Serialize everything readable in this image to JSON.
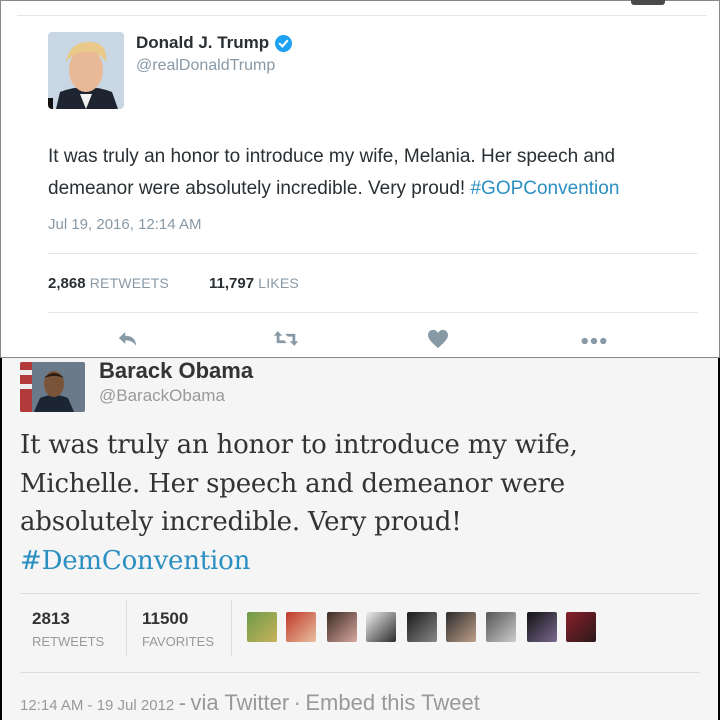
{
  "tweet1": {
    "name": "Donald J. Trump",
    "handle": "@realDonaldTrump",
    "text_line1": "It was truly an honor to introduce my wife, Melania. Her speech and",
    "text_line2_pre": "demeanor were absolutely incredible. Very proud! ",
    "hashtag": "#GOPConvention",
    "timestamp": "Jul 19, 2016, 12:14 AM",
    "retweets_count": "2,868",
    "retweets_label": "RETWEETS",
    "likes_count": "11,797",
    "likes_label": "LIKES",
    "verified_color": "#1da1f2",
    "icons": [
      "reply-icon",
      "retweet-icon",
      "heart-icon",
      "more-icon"
    ]
  },
  "tweet2": {
    "name": "Barack Obama",
    "handle": "@BarackObama",
    "text_line1": "It was truly an honor to introduce my wife,",
    "text_line2": "Michelle. Her speech and demeanor were",
    "text_line3": "absolutely incredible. Very proud!",
    "hashtag": "#DemConvention",
    "retweets_count": "2813",
    "retweets_label": "RETWEETS",
    "favorites_count": "11500",
    "favorites_label": "FAVORITES",
    "timestamp": "12:14 AM - 19 Jul 2012",
    "separator": "-",
    "via": "via Twitter",
    "dot": "·",
    "embed": "Embed this Tweet"
  },
  "colors": {
    "hashtag": "#2b8fc1",
    "muted": "#8899a6",
    "text": "#292f33"
  }
}
